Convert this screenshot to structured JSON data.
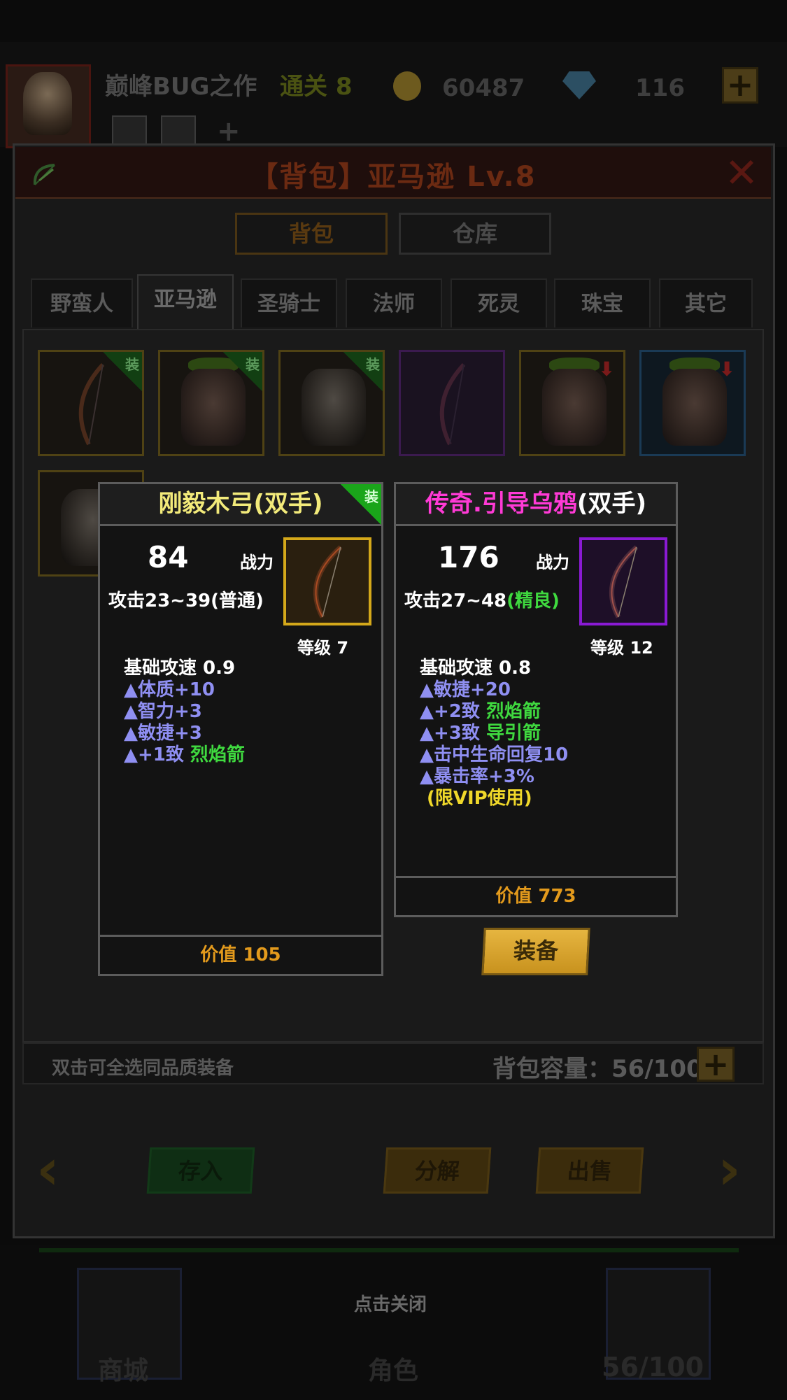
{
  "hud": {
    "player_name": "巅峰BUG之作",
    "stage": "通关 8",
    "gold": "60487",
    "gems": "116",
    "plus": "+"
  },
  "dialog": {
    "title": "【背包】亚马逊 Lv.8",
    "close": "✕",
    "tabs": [
      "背包",
      "仓库"
    ],
    "categories": [
      "野蛮人",
      "亚马逊",
      "圣骑士",
      "法师",
      "死灵",
      "珠宝",
      "其它"
    ],
    "active_category": "亚马逊",
    "hint": "双击可全选同品质装备",
    "capacity": "背包容量：56/100",
    "capacity_plus": "+",
    "buttons": {
      "store": "存入",
      "decompose": "分解",
      "sell": "出售"
    },
    "nav_prev": "‹",
    "nav_next": "›",
    "slot_equipped_tag": "装"
  },
  "card_left": {
    "name": "刚毅木弓(双手)",
    "equipped_tag": "装",
    "power": "84",
    "power_label": "战力",
    "attack": "攻击23~39",
    "quality": "(普通)",
    "level": "等级 7",
    "stats": [
      {
        "text": "基础攻速 0.9",
        "accent": ""
      },
      {
        "text": "▲体质+10",
        "accent": ""
      },
      {
        "text": "▲智力+3",
        "accent": ""
      },
      {
        "text": "▲敏捷+3",
        "accent": ""
      },
      {
        "text": "▲+1致 ",
        "accent": "烈焰箭"
      }
    ],
    "value": "价值 105"
  },
  "card_right": {
    "name": "传奇.引导乌鸦",
    "name_suffix": "(双手)",
    "power": "176",
    "power_label": "战力",
    "attack": "攻击27~48",
    "quality": "(精良)",
    "level": "等级 12",
    "stats": [
      {
        "text": "基础攻速 0.8",
        "accent": ""
      },
      {
        "text": "▲敏捷+20",
        "accent": ""
      },
      {
        "text": "▲+2致 ",
        "accent": "烈焰箭"
      },
      {
        "text": "▲+3致 ",
        "accent": "导引箭"
      },
      {
        "text": "▲击中生命回复10",
        "accent": ""
      },
      {
        "text": "▲暴击率+3%",
        "accent": ""
      }
    ],
    "vip_note": "(限VIP使用)",
    "value": "价值 773",
    "equip_button": "装备"
  },
  "bottom": {
    "close_hint": "点击关闭",
    "nav_shop": "商城",
    "nav_role": "角色",
    "nav_bag": "56/100"
  },
  "colors": {
    "legendary_name": "#ff3ad6",
    "common_name": "#f2ea7a",
    "gold_text": "#e39a1c",
    "stat_blue": "#8f8ff2",
    "accent_green": "#3fd93f",
    "vip_yellow": "#f0d82a"
  }
}
